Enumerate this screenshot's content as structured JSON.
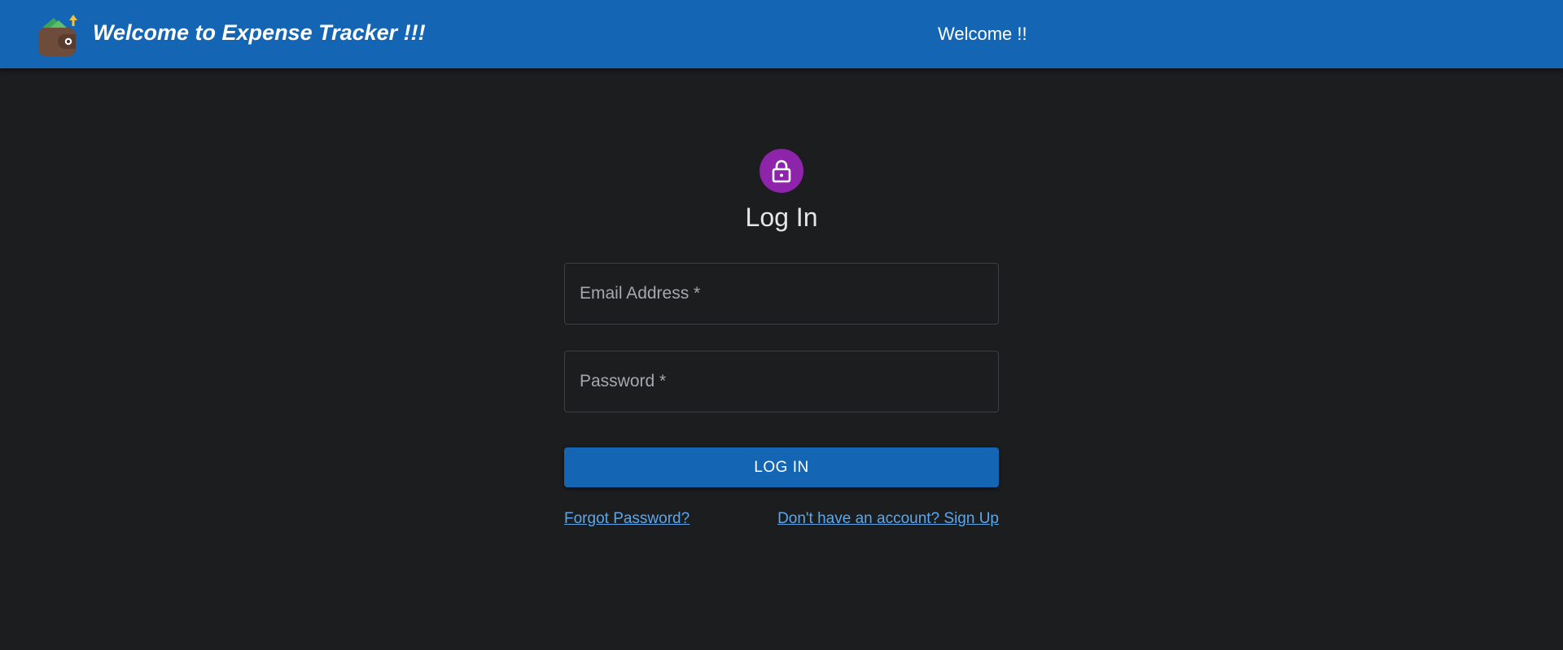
{
  "header": {
    "logo_icon": "wallet-icon",
    "title": "Welcome to Expense Tracker !!!",
    "welcome": "Welcome !!",
    "color": "#1565b5"
  },
  "login": {
    "avatar_icon": "lock-icon",
    "avatar_color": "#8e24aa",
    "heading": "Log In",
    "email": {
      "label": "Email Address *",
      "value": ""
    },
    "password": {
      "label": "Password *",
      "value": ""
    },
    "submit_label": "LOG IN",
    "forgot_password_label": "Forgot Password?",
    "signup_label": "Don't have an account? Sign Up",
    "link_color": "#5aa7ee"
  }
}
